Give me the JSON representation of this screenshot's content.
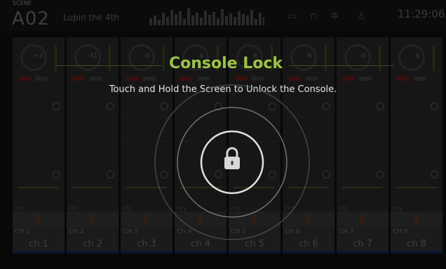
{
  "top_bar": {
    "scene_label": "SCENE",
    "scene_id": "A02",
    "scene_name": "Lupin the 4th",
    "clock": "11:29:06",
    "icons": [
      "monitor-icon",
      "headphones-icon",
      "gear-icon",
      "person-icon"
    ]
  },
  "channels": [
    {
      "label": "CH 1",
      "name": "ch 1",
      "value": "+2",
      "fx": "FX1"
    },
    {
      "label": "CH 2",
      "name": "ch 2",
      "value": "-31",
      "fx": "FX1"
    },
    {
      "label": "CH 3",
      "name": "ch 3",
      "value": "-6",
      "fx": "FX1"
    },
    {
      "label": "CH 4",
      "name": "ch 4",
      "value": "-6",
      "fx": "FX1"
    },
    {
      "label": "CH 5",
      "name": "ch 5",
      "value": "-6",
      "fx": "FX1"
    },
    {
      "label": "CH 6",
      "name": "ch 6",
      "value": "-6",
      "fx": "FX1"
    },
    {
      "label": "CH 7",
      "name": "ch 7",
      "value": "-6",
      "fx": "FX1"
    },
    {
      "label": "CH 8",
      "name": "ch 8",
      "value": "-6",
      "fx": "FX1"
    }
  ],
  "lock": {
    "title": "Console Lock",
    "message": "Touch and Hold the Screen to Unlock the Console.",
    "icon": "lock-icon"
  },
  "colors": {
    "title_green": "#9dc43e",
    "message_text": "#e6e6e6",
    "background": "#080808"
  }
}
